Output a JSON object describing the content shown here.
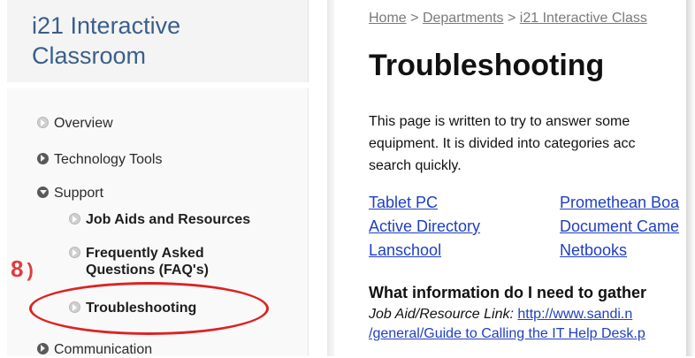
{
  "sidebar": {
    "site_title": "i21 Interactive Classroom",
    "items": [
      {
        "label": "Overview"
      },
      {
        "label": "Technology Tools"
      },
      {
        "label": "Support"
      },
      {
        "label": "Job Aids and Resources"
      },
      {
        "label": "Frequently Asked Questions (FAQ's)"
      },
      {
        "label": "Troubleshooting"
      },
      {
        "label": "Communication"
      }
    ]
  },
  "annotation": {
    "step_label": "8"
  },
  "content": {
    "breadcrumb": [
      "Home",
      "Departments",
      "i21 Interactive Class"
    ],
    "breadcrumb_separator": ">",
    "title": "Troubleshooting",
    "intro_lines": [
      "This page is written to try to answer some",
      "equipment. It is divided into categories acc",
      "search quickly."
    ],
    "links": [
      "Tablet PC",
      "Promethean Boa",
      "Active Directory",
      "Document Came",
      "Lanschool",
      "Netbooks"
    ],
    "question_heading": "What information do I need to gather",
    "job_aid_label": "Job Aid/Resource Link:",
    "job_aid_url": "http://www.sandi.n",
    "job_aid_url_cont": "/general/Guide to Calling the IT Help Desk.p"
  }
}
